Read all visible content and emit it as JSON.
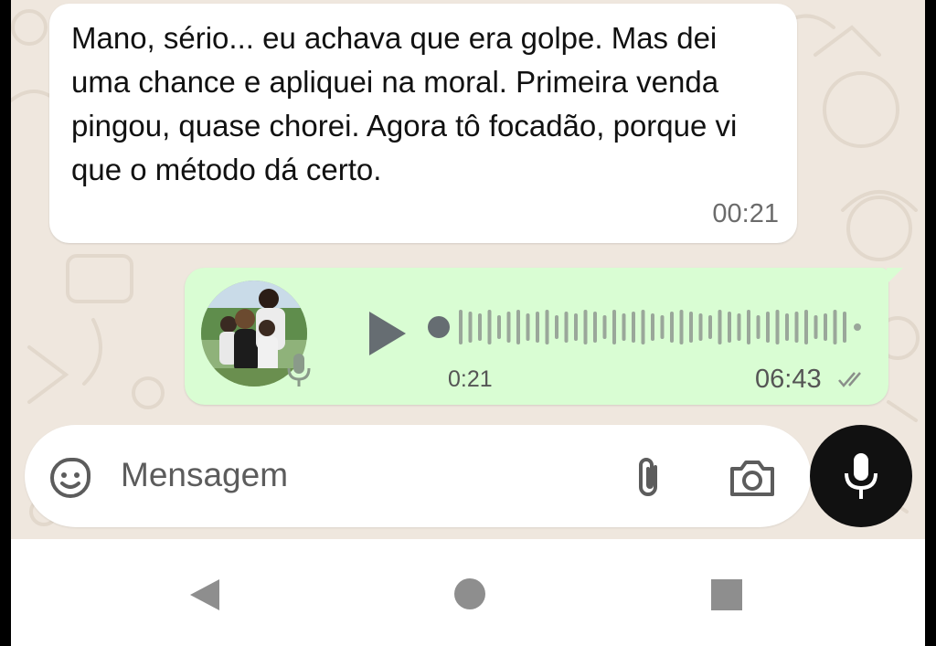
{
  "chat": {
    "incoming_message": {
      "text": "Mano, sério... eu achava que era golpe. Mas dei uma chance e apliquei na moral. Primeira venda pingou, quase chorei. Agora tô focadão, porque vi que o método dá certo.",
      "time": "00:21"
    },
    "outgoing_voice_note": {
      "duration": "0:21",
      "time": "06:43",
      "status": "delivered",
      "playback_progress": 0
    }
  },
  "composer": {
    "placeholder": "Mensagem"
  },
  "icons": {
    "emoji": "sticker-icon",
    "attach": "paperclip-icon",
    "camera": "camera-icon",
    "mic": "microphone-icon",
    "nav_back": "back-triangle-icon",
    "nav_home": "home-circle-icon",
    "nav_recent": "recents-square-icon"
  },
  "colors": {
    "chat_background": "#efe7de",
    "incoming_bubble": "#ffffff",
    "outgoing_bubble": "#d9fdd3",
    "mic_button": "#111111",
    "nav_icons": "#8e8e8e"
  }
}
